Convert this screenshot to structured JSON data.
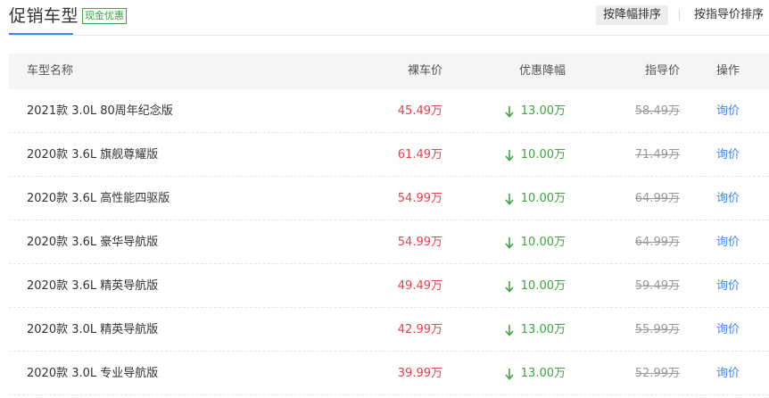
{
  "header": {
    "title": "促销车型",
    "badge": "现金优惠",
    "sort_by_discount": "按降幅排序",
    "sort_by_guide": "按指导价排序"
  },
  "table": {
    "columns": {
      "name": "车型名称",
      "price": "裸车价",
      "discount": "优惠降幅",
      "guide": "指导价",
      "action": "操作"
    },
    "rows": [
      {
        "name": "2021款 3.0L 80周年纪念版",
        "price": "45.49万",
        "discount": "13.00万",
        "guide": "58.49万",
        "action": "询价"
      },
      {
        "name": "2020款 3.6L 旗舰尊耀版",
        "price": "61.49万",
        "discount": "10.00万",
        "guide": "71.49万",
        "action": "询价"
      },
      {
        "name": "2020款 3.6L 高性能四驱版",
        "price": "54.99万",
        "discount": "10.00万",
        "guide": "64.99万",
        "action": "询价"
      },
      {
        "name": "2020款 3.6L 豪华导航版",
        "price": "54.99万",
        "discount": "10.00万",
        "guide": "64.99万",
        "action": "询价"
      },
      {
        "name": "2020款 3.6L 精英导航版",
        "price": "49.49万",
        "discount": "10.00万",
        "guide": "59.49万",
        "action": "询价"
      },
      {
        "name": "2020款 3.0L 精英导航版",
        "price": "42.99万",
        "discount": "13.00万",
        "guide": "55.99万",
        "action": "询价"
      },
      {
        "name": "2020款 3.0L 专业导航版",
        "price": "39.99万",
        "discount": "13.00万",
        "guide": "52.99万",
        "action": "询价"
      }
    ]
  },
  "colors": {
    "price": "#e8414a",
    "discount": "#3fa33f",
    "link": "#3e86f1",
    "accent": "#3e86f1"
  },
  "icons": {
    "discount_arrow": "arrow-down-icon"
  }
}
